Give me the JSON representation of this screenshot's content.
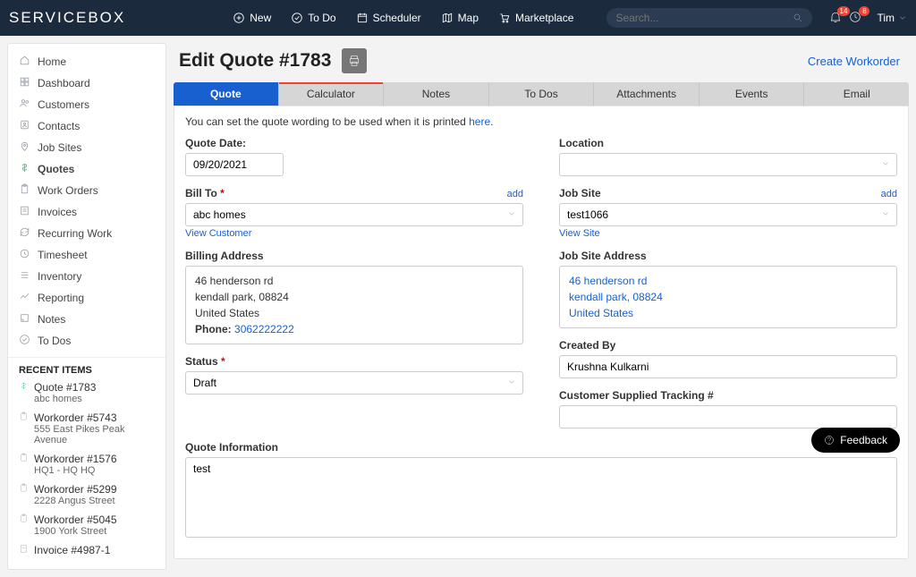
{
  "brand": "SERVICEBOX",
  "top": {
    "new": "New",
    "todo": "To Do",
    "scheduler": "Scheduler",
    "map": "Map",
    "marketplace": "Marketplace",
    "search_placeholder": "Search...",
    "badge1": "14",
    "badge2": "8",
    "user": "Tim"
  },
  "sidebar": {
    "items": [
      {
        "label": "Home"
      },
      {
        "label": "Dashboard"
      },
      {
        "label": "Customers"
      },
      {
        "label": "Contacts"
      },
      {
        "label": "Job Sites"
      },
      {
        "label": "Quotes"
      },
      {
        "label": "Work Orders"
      },
      {
        "label": "Invoices"
      },
      {
        "label": "Recurring Work"
      },
      {
        "label": "Timesheet"
      },
      {
        "label": "Inventory"
      },
      {
        "label": "Reporting"
      },
      {
        "label": "Notes"
      },
      {
        "label": "To Dos"
      }
    ],
    "recent_header": "RECENT ITEMS",
    "recent": [
      {
        "title": "Quote #1783",
        "sub": "abc homes"
      },
      {
        "title": "Workorder #5743",
        "sub": "555 East Pikes Peak Avenue"
      },
      {
        "title": "Workorder #1576",
        "sub": "HQ1 - HQ HQ"
      },
      {
        "title": "Workorder #5299",
        "sub": "2228 Angus Street"
      },
      {
        "title": "Workorder #5045",
        "sub": "1900 York Street"
      },
      {
        "title": "Invoice #4987-1",
        "sub": ""
      }
    ]
  },
  "page": {
    "title": "Edit Quote #1783",
    "create_link": "Create Workorder"
  },
  "tabs": [
    "Quote",
    "Calculator",
    "Notes",
    "To Dos",
    "Attachments",
    "Events",
    "Email"
  ],
  "hint": {
    "text": "You can set the quote wording to be used when it is printed ",
    "link": "here"
  },
  "form": {
    "quote_date_label": "Quote Date:",
    "quote_date": "09/20/2021",
    "location_label": "Location",
    "location": "",
    "bill_to_label": "Bill To",
    "bill_to": "abc homes",
    "bill_to_add": "add",
    "view_customer": "View Customer",
    "job_site_label": "Job Site",
    "job_site": "test1066",
    "job_site_add": "add",
    "view_site": "View Site",
    "billing_addr_label": "Billing Address",
    "billing_addr": {
      "line1": "46 henderson rd",
      "line2": "kendall park, 08824",
      "line3": "United States",
      "phone_label": "Phone:",
      "phone": "3062222222"
    },
    "jobsite_addr_label": "Job Site Address",
    "jobsite_addr": {
      "line1": "46 henderson rd",
      "line2": "kendall park, 08824",
      "line3": "United States"
    },
    "status_label": "Status",
    "status": "Draft",
    "created_by_label": "Created By",
    "created_by": "Krushna Kulkarni",
    "tracking_label": "Customer Supplied Tracking #",
    "tracking": "",
    "quote_info_label": "Quote Information",
    "quote_info": "test"
  },
  "feedback": "Feedback"
}
